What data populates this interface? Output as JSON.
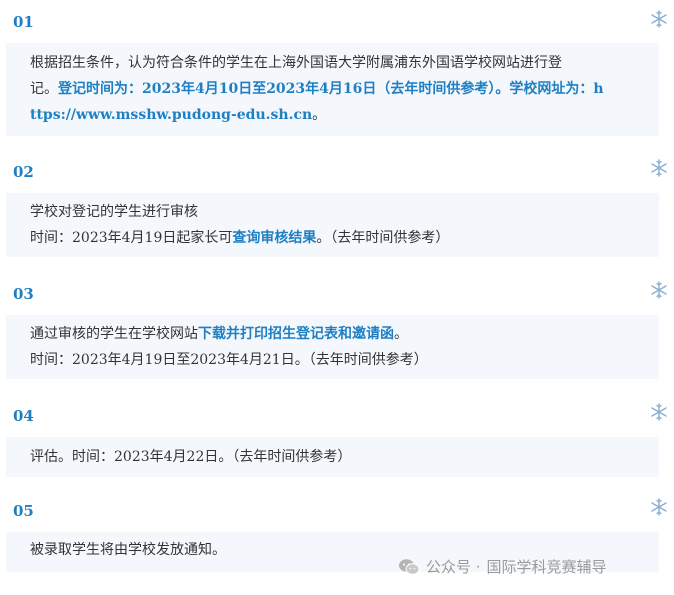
{
  "steps": [
    {
      "num": "01",
      "lines": [
        {
          "text": "根据招生条件，认为符合条件的学生在上海外国语大学附属浦东外国语学校网站进行登"
        },
        {
          "text": "记。",
          "blue": "登记时间为：2023年4月10日至2023年4月16日（去年时间供参考）。学校网址为：h"
        },
        {
          "blue": "ttps://www.msshw.pudong-edu.sh.cn",
          "after": "。"
        }
      ]
    },
    {
      "num": "02",
      "lines": [
        {
          "text": "学校对登记的学生进行审核"
        },
        {
          "text": "时间：2023年4月19日起家长可",
          "blue": "查询审核结果",
          "after": "。（去年时间供参考）"
        }
      ]
    },
    {
      "num": "03",
      "lines": [
        {
          "text": "通过审核的学生在学校网站",
          "blue": "下载并打印招生登记表和邀请函",
          "after": "。"
        },
        {
          "text": "时间：2023年4月19日至2023年4月21日。（去年时间供参考）"
        }
      ]
    },
    {
      "num": "04",
      "lines": [
        {
          "text": "评估。时间：2023年4月22日。（去年时间供参考）"
        }
      ]
    },
    {
      "num": "05",
      "lines": [
        {
          "text": "被录取学生将由学校发放通知。"
        }
      ]
    }
  ],
  "watermark": {
    "prefix": "公众号 ·",
    "name": "国际学科竞赛辅导"
  },
  "icons": {
    "step_decoration": "snowflake-icon",
    "watermark_logo": "wechat-icon"
  },
  "colors": {
    "accent": "#1e7fc3",
    "box_bg": "#f4f8fd",
    "text": "#333333"
  }
}
